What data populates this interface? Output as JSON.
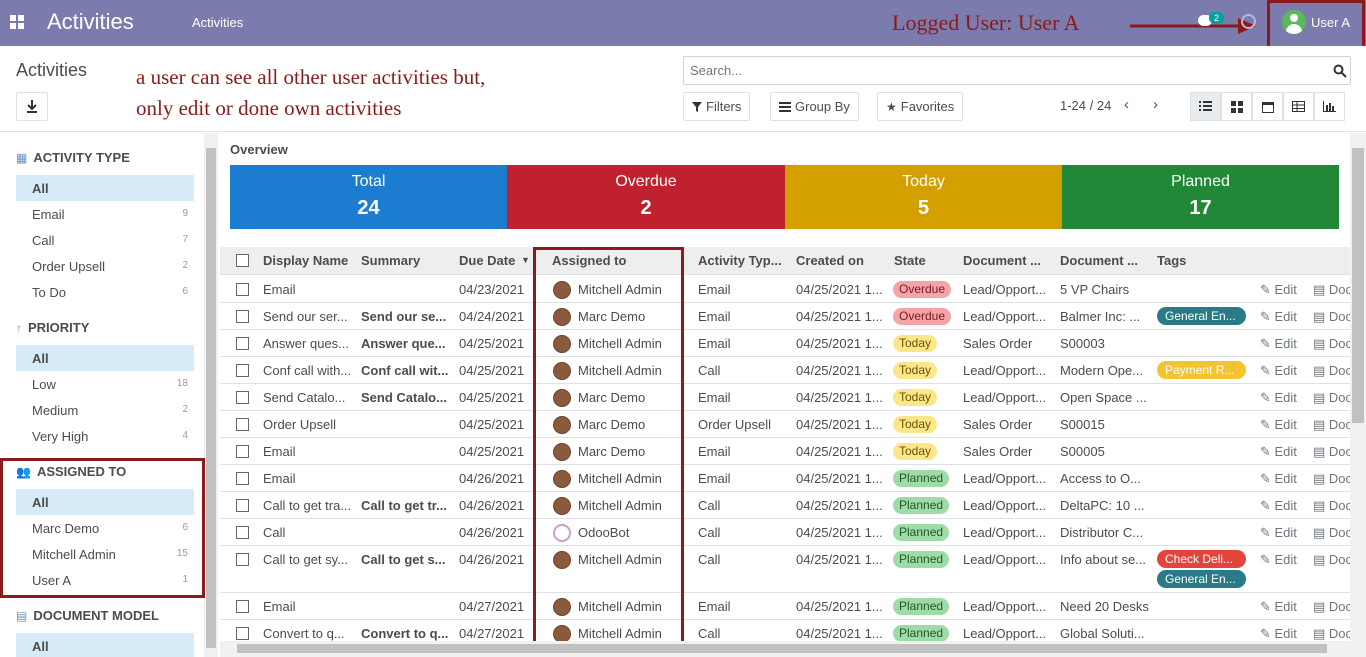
{
  "navbar": {
    "brand": "Activities",
    "menu": "Activities",
    "annotation": "Logged User: User A",
    "chat_count": "2",
    "user": "User A"
  },
  "control_panel": {
    "breadcrumb": "Activities",
    "annotation_line1": "a user can see all other user activities but,",
    "annotation_line2": "only edit or done own activities",
    "search_placeholder": "Search...",
    "filters": "Filters",
    "group_by": "Group By",
    "favorites": "Favorites",
    "pager": "1-24 / 24"
  },
  "sidebar": {
    "sections": [
      {
        "title": "ACTIVITY TYPE",
        "items": [
          {
            "label": "All",
            "count": ""
          },
          {
            "label": "Email",
            "count": "9"
          },
          {
            "label": "Call",
            "count": "7"
          },
          {
            "label": "Order Upsell",
            "count": "2"
          },
          {
            "label": "To Do",
            "count": "6"
          }
        ]
      },
      {
        "title": "PRIORITY",
        "items": [
          {
            "label": "All",
            "count": ""
          },
          {
            "label": "Low",
            "count": "18"
          },
          {
            "label": "Medium",
            "count": "2"
          },
          {
            "label": "Very High",
            "count": "4"
          }
        ]
      },
      {
        "title": "ASSIGNED TO",
        "items": [
          {
            "label": "All",
            "count": ""
          },
          {
            "label": "Marc Demo",
            "count": "6"
          },
          {
            "label": "Mitchell Admin",
            "count": "15"
          },
          {
            "label": "User A",
            "count": "1"
          }
        ]
      },
      {
        "title": "DOCUMENT MODEL",
        "items": [
          {
            "label": "All",
            "count": ""
          }
        ]
      }
    ]
  },
  "overview": {
    "title": "Overview",
    "cards": [
      {
        "label": "Total",
        "value": "24",
        "color": "#1c7ccf"
      },
      {
        "label": "Overdue",
        "value": "2",
        "color": "#c0212f"
      },
      {
        "label": "Today",
        "value": "5",
        "color": "#d4a000"
      },
      {
        "label": "Planned",
        "value": "17",
        "color": "#218838"
      }
    ]
  },
  "table": {
    "headers": [
      "Display Name",
      "Summary",
      "Due Date",
      "Assigned to",
      "Activity Typ...",
      "Created on",
      "State",
      "Document ...",
      "Document ...",
      "Tags"
    ],
    "edit_label": "Edit",
    "doc_label": "Doc",
    "rows": [
      {
        "name": "Email",
        "summary": "",
        "due": "04/23/2021",
        "assigned": "Mitchell Admin",
        "type": "Email",
        "created": "04/25/2021 1...",
        "state": "Overdue",
        "model": "Lead/Opport...",
        "doc": "5 VP Chairs",
        "tags": []
      },
      {
        "name": "Send our ser...",
        "summary": "Send our se...",
        "due": "04/24/2021",
        "assigned": "Marc Demo",
        "type": "Email",
        "created": "04/25/2021 1...",
        "state": "Overdue",
        "model": "Lead/Opport...",
        "doc": "Balmer Inc: ...",
        "tags": [
          {
            "label": "General En...",
            "color": "#2a7b88"
          }
        ]
      },
      {
        "name": "Answer ques...",
        "summary": "Answer que...",
        "due": "04/25/2021",
        "assigned": "Mitchell Admin",
        "type": "Email",
        "created": "04/25/2021 1...",
        "state": "Today",
        "model": "Sales Order",
        "doc": "S00003",
        "tags": []
      },
      {
        "name": "Conf call with...",
        "summary": "Conf call wit...",
        "due": "04/25/2021",
        "assigned": "Mitchell Admin",
        "type": "Call",
        "created": "04/25/2021 1...",
        "state": "Today",
        "model": "Lead/Opport...",
        "doc": "Modern Ope...",
        "tags": [
          {
            "label": "Payment R...",
            "color": "#f4c430"
          }
        ]
      },
      {
        "name": "Send Catalo...",
        "summary": "Send Catalo...",
        "due": "04/25/2021",
        "assigned": "Marc Demo",
        "type": "Email",
        "created": "04/25/2021 1...",
        "state": "Today",
        "model": "Lead/Opport...",
        "doc": "Open Space ...",
        "tags": []
      },
      {
        "name": "Order Upsell",
        "summary": "",
        "due": "04/25/2021",
        "assigned": "Marc Demo",
        "type": "Order Upsell",
        "created": "04/25/2021 1...",
        "state": "Today",
        "model": "Sales Order",
        "doc": "S00015",
        "tags": []
      },
      {
        "name": "Email",
        "summary": "",
        "due": "04/25/2021",
        "assigned": "Marc Demo",
        "type": "Email",
        "created": "04/25/2021 1...",
        "state": "Today",
        "model": "Sales Order",
        "doc": "S00005",
        "tags": []
      },
      {
        "name": "Email",
        "summary": "",
        "due": "04/26/2021",
        "assigned": "Mitchell Admin",
        "type": "Email",
        "created": "04/25/2021 1...",
        "state": "Planned",
        "model": "Lead/Opport...",
        "doc": "Access to O...",
        "tags": []
      },
      {
        "name": "Call to get tra...",
        "summary": "Call to get tr...",
        "due": "04/26/2021",
        "assigned": "Mitchell Admin",
        "type": "Call",
        "created": "04/25/2021 1...",
        "state": "Planned",
        "model": "Lead/Opport...",
        "doc": "DeltaPC: 10 ...",
        "tags": []
      },
      {
        "name": "Call",
        "summary": "",
        "due": "04/26/2021",
        "assigned": "OdooBot",
        "type": "Call",
        "created": "04/25/2021 1...",
        "state": "Planned",
        "model": "Lead/Opport...",
        "doc": "Distributor C...",
        "tags": []
      },
      {
        "name": "Call to get sy...",
        "summary": "Call to get s...",
        "due": "04/26/2021",
        "assigned": "Mitchell Admin",
        "type": "Call",
        "created": "04/25/2021 1...",
        "state": "Planned",
        "model": "Lead/Opport...",
        "doc": "Info about se...",
        "tags": [
          {
            "label": "Check Deli...",
            "color": "#e2453c"
          },
          {
            "label": "General En...",
            "color": "#2a7b88"
          }
        ]
      },
      {
        "name": "Email",
        "summary": "",
        "due": "04/27/2021",
        "assigned": "Mitchell Admin",
        "type": "Email",
        "created": "04/25/2021 1...",
        "state": "Planned",
        "model": "Lead/Opport...",
        "doc": "Need 20 Desks",
        "tags": []
      },
      {
        "name": "Convert to q...",
        "summary": "Convert to q...",
        "due": "04/27/2021",
        "assigned": "Mitchell Admin",
        "type": "Call",
        "created": "04/25/2021 1...",
        "state": "Planned",
        "model": "Lead/Opport...",
        "doc": "Global Soluti...",
        "tags": []
      }
    ]
  },
  "state_colors": {
    "Overdue": {
      "bg": "#f4a4a8",
      "fg": "#7a1a20"
    },
    "Today": {
      "bg": "#fde68a",
      "fg": "#6b5200"
    },
    "Planned": {
      "bg": "#9fdba6",
      "fg": "#1d5a27"
    }
  }
}
